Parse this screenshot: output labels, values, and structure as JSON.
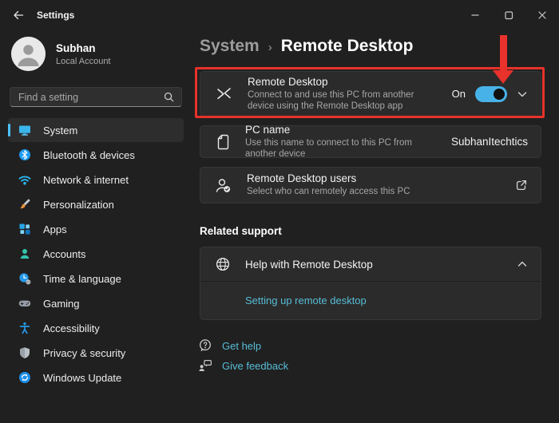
{
  "window": {
    "title": "Settings"
  },
  "sidebar": {
    "user": {
      "name": "Subhan",
      "type": "Local Account"
    },
    "search": {
      "placeholder": "Find a setting"
    },
    "items": [
      {
        "label": "System",
        "selected": true
      },
      {
        "label": "Bluetooth & devices"
      },
      {
        "label": "Network & internet"
      },
      {
        "label": "Personalization"
      },
      {
        "label": "Apps"
      },
      {
        "label": "Accounts"
      },
      {
        "label": "Time & language"
      },
      {
        "label": "Gaming"
      },
      {
        "label": "Accessibility"
      },
      {
        "label": "Privacy & security"
      },
      {
        "label": "Windows Update"
      }
    ]
  },
  "main": {
    "breadcrumb": {
      "parent": "System",
      "separator": "›",
      "current": "Remote Desktop"
    },
    "remote_desktop_card": {
      "title": "Remote Desktop",
      "description": "Connect to and use this PC from another device using the Remote Desktop app",
      "toggle_label": "On",
      "toggle_state": "on"
    },
    "pc_name_card": {
      "title": "PC name",
      "description": "Use this name to connect to this PC from another device",
      "value": "SubhanItechtics"
    },
    "users_card": {
      "title": "Remote Desktop users",
      "description": "Select who can remotely access this PC"
    },
    "related_support": {
      "heading": "Related support",
      "help_title": "Help with Remote Desktop",
      "help_link": "Setting up remote desktop"
    },
    "footer": {
      "get_help": "Get help",
      "give_feedback": "Give feedback"
    }
  },
  "colors": {
    "accent": "#4cc2ff",
    "toggle": "#47b2e8",
    "link": "#57bdd6",
    "annotation": "#e8322b"
  }
}
